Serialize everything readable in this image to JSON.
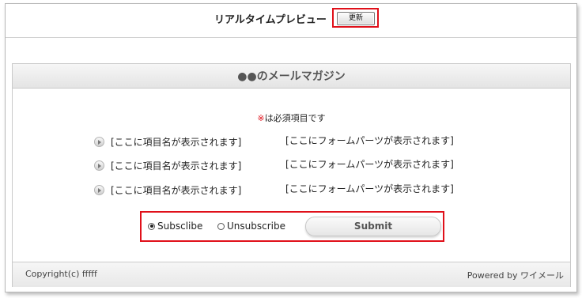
{
  "header": {
    "title": "リアルタイムプレビュー",
    "update_button": "更新"
  },
  "form": {
    "title": "●●のメールマガジン",
    "required_mark": "※",
    "required_text": "は必須項目です",
    "rows": [
      {
        "label": "[ここに項目名が表示されます]",
        "part": "[ここにフォームパーツが表示されます]"
      },
      {
        "label": "[ここに項目名が表示されます]",
        "part": "[ここにフォームパーツが表示されます]"
      },
      {
        "label": "[ここに項目名が表示されます]",
        "part": "[ここにフォームパーツが表示されます]"
      }
    ],
    "subscription": {
      "subscribe_label": "Subsclibe",
      "subscribe_selected": true,
      "unsubscribe_label": "Unsubscribe",
      "unsubscribe_selected": false,
      "submit_label": "Submit"
    }
  },
  "footer": {
    "copyright": "Copyright(c) fffff",
    "powered": "Powered by ワイメール"
  },
  "colors": {
    "highlight": "#e0101a",
    "required_mark": "#e0101a"
  }
}
